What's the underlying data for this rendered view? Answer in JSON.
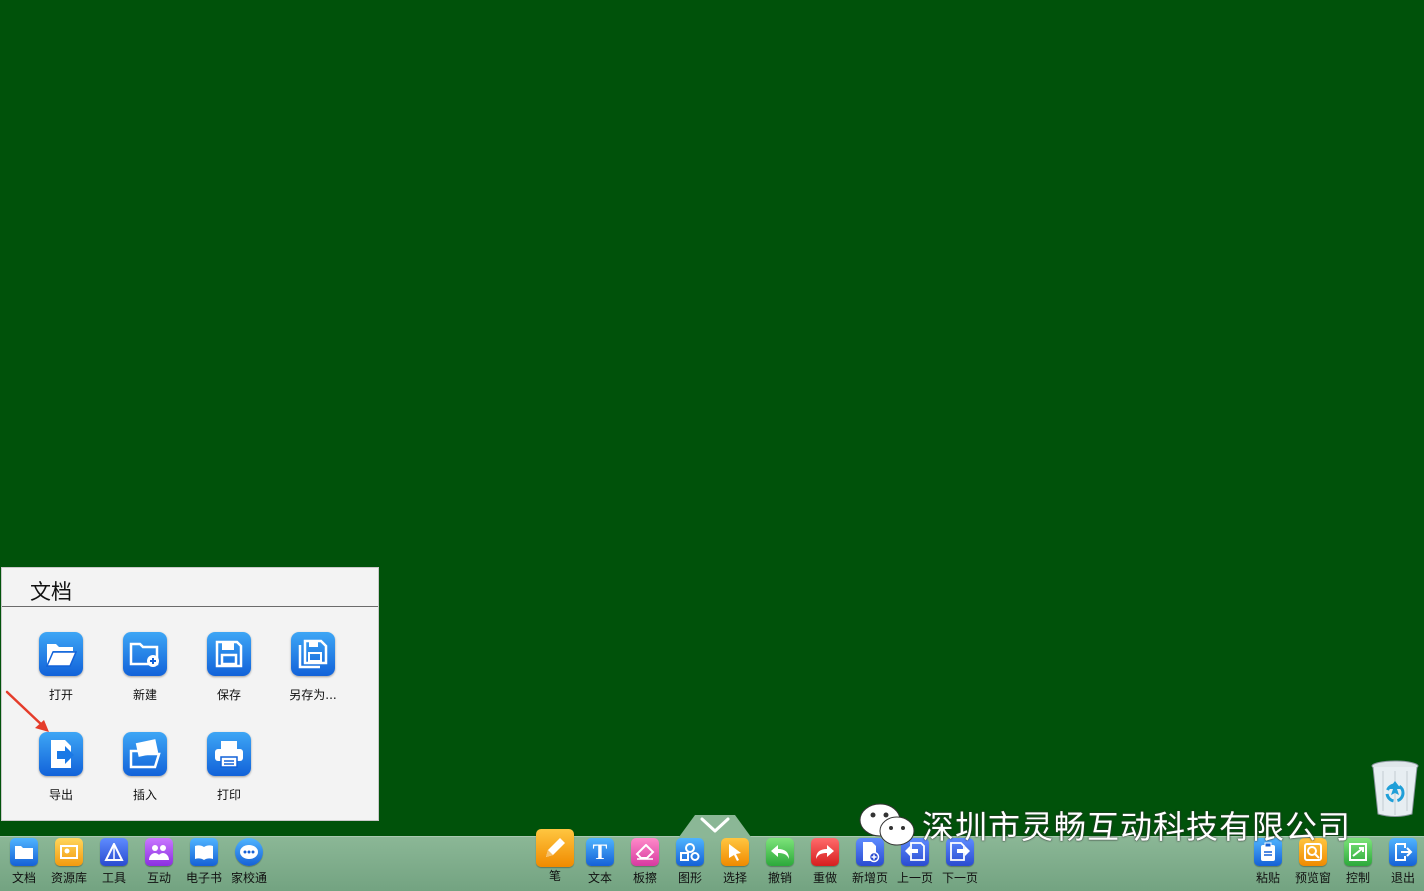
{
  "panel": {
    "title": "文档",
    "items": [
      {
        "label": "打开",
        "icon": "folder-open-icon"
      },
      {
        "label": "新建",
        "icon": "new-folder-icon"
      },
      {
        "label": "保存",
        "icon": "save-icon"
      },
      {
        "label": "另存为...",
        "icon": "save-as-icon"
      },
      {
        "label": "导出",
        "icon": "export-icon"
      },
      {
        "label": "插入",
        "icon": "insert-image-icon"
      },
      {
        "label": "打印",
        "icon": "printer-icon"
      }
    ]
  },
  "taskbar": {
    "left": [
      {
        "label": "文档",
        "icon": "document-folder-icon"
      },
      {
        "label": "资源库",
        "icon": "library-icon"
      },
      {
        "label": "工具",
        "icon": "tools-icon"
      },
      {
        "label": "互动",
        "icon": "interaction-icon"
      },
      {
        "label": "电子书",
        "icon": "ebook-icon"
      },
      {
        "label": "家校通",
        "icon": "home-school-icon"
      }
    ],
    "center": [
      {
        "label": "笔",
        "icon": "pen-icon"
      },
      {
        "label": "文本",
        "icon": "text-icon"
      },
      {
        "label": "板擦",
        "icon": "eraser-icon"
      },
      {
        "label": "图形",
        "icon": "shapes-icon"
      },
      {
        "label": "选择",
        "icon": "select-cursor-icon"
      },
      {
        "label": "撤销",
        "icon": "undo-icon"
      },
      {
        "label": "重做",
        "icon": "redo-icon"
      },
      {
        "label": "新增页",
        "icon": "add-page-icon"
      },
      {
        "label": "上一页",
        "icon": "previous-page-icon"
      },
      {
        "label": "下一页",
        "icon": "next-page-icon"
      }
    ],
    "right": [
      {
        "label": "粘贴",
        "icon": "paste-icon"
      },
      {
        "label": "预览窗",
        "icon": "preview-icon"
      },
      {
        "label": "控制",
        "icon": "control-icon"
      },
      {
        "label": "退出",
        "icon": "exit-icon"
      }
    ]
  },
  "watermark": {
    "text": "深圳市灵畅互动科技有限公司",
    "icon": "wechat-icon"
  },
  "colors": {
    "board": "#00520a",
    "taskbar": "#7fac8a",
    "icon_blue": "#1e7fe8"
  }
}
